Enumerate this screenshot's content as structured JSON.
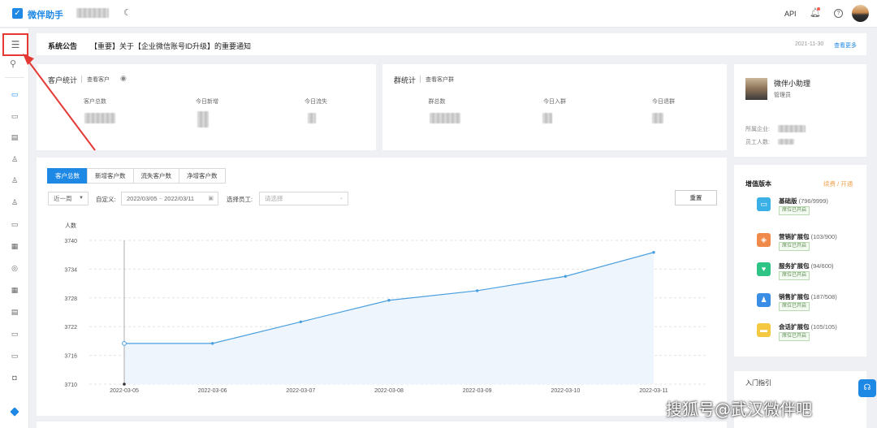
{
  "app": {
    "title": "微伴助手",
    "api_label": "API"
  },
  "sidebar": {
    "menu_icon": "hamburger-icon",
    "search_icon": "search-icon"
  },
  "notice": {
    "title": "系统公告",
    "text": "【重要】关于【企业微信账号ID升级】的重要通知",
    "date": "2021-11-30",
    "more": "查看更多"
  },
  "customer_stats": {
    "title": "客户统计",
    "link": "查看客户",
    "labels": [
      "客户总数",
      "今日新增",
      "今日流失"
    ]
  },
  "group_stats": {
    "title": "群统计",
    "link": "查看客户群",
    "labels": [
      "群总数",
      "今日入群",
      "今日退群"
    ]
  },
  "chart_panel": {
    "tabs": [
      "客户总数",
      "新增客户数",
      "流失客户数",
      "净增客户数"
    ],
    "range_select": "近一周",
    "custom_label": "自定义:",
    "date_start": "2022/03/05",
    "date_sep": "~",
    "date_end": "2022/03/11",
    "employee_label": "选择员工:",
    "employee_placeholder": "请选择",
    "reset": "重置"
  },
  "chart_data": {
    "type": "area",
    "ylabel": "人数",
    "x": [
      "2022-03-05",
      "2022-03-06",
      "2022-03-07",
      "2022-03-08",
      "2022-03-09",
      "2022-03-10",
      "2022-03-11"
    ],
    "values": [
      3718.5,
      3718.5,
      3723,
      3727.5,
      3729.5,
      3732.5,
      3737.5
    ],
    "yticks": [
      3710,
      3716,
      3722,
      3728,
      3734,
      3740
    ],
    "ylim": [
      3710,
      3740
    ],
    "grid": true,
    "color": "#4a9fe0"
  },
  "assistant": {
    "name": "微伴小助理",
    "role": "管理员",
    "company_label": "所属企业:",
    "staff_label": "员工人数:"
  },
  "value_added": {
    "title": "增值版本",
    "link": "续费 / 开通",
    "items": [
      {
        "name": "基础版",
        "count": "(796/9999)",
        "badge": "席位已开启",
        "icon": "desktop-icon",
        "color": "#3ab0e6"
      },
      {
        "name": "营销扩展包",
        "count": "(103/900)",
        "badge": "席位已开启",
        "icon": "megaphone-icon",
        "color": "#f08a4b"
      },
      {
        "name": "服务扩展包",
        "count": "(94/600)",
        "badge": "席位已开启",
        "icon": "heart-hand-icon",
        "color": "#2ec486"
      },
      {
        "name": "销售扩展包",
        "count": "(187/508)",
        "badge": "席位已开启",
        "icon": "users-icon",
        "color": "#3a8ee6"
      },
      {
        "name": "会话扩展包",
        "count": "(105/105)",
        "badge": "席位已开启",
        "icon": "chat-icon",
        "color": "#f5c842"
      }
    ]
  },
  "guide": {
    "title": "入门指引"
  },
  "watermark": "搜狐号@武汉微伴吧"
}
